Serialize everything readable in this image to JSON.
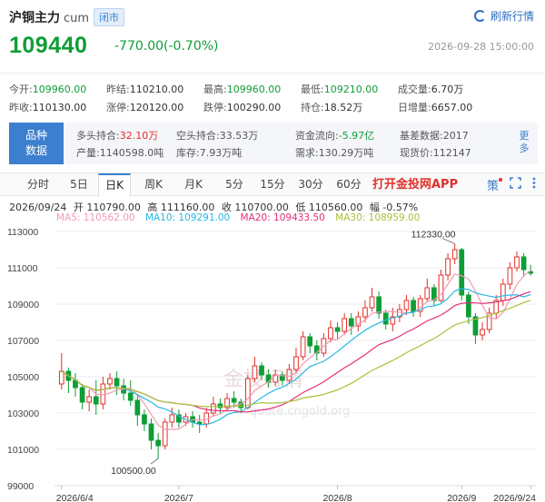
{
  "header": {
    "name": "沪铜主力",
    "code": "cum",
    "status_badge": "闭市",
    "refresh_label": "刷新行情"
  },
  "quote": {
    "price": "109440",
    "change": "-770.00(-0.70%)",
    "datetime": "2026-09-28 15:00:00"
  },
  "stats": {
    "row1": [
      {
        "label": "今开:",
        "value": "109960.00",
        "tone": "green"
      },
      {
        "label": "昨结:",
        "value": "110210.00",
        "tone": ""
      },
      {
        "label": "最高:",
        "value": "109960.00",
        "tone": "green"
      },
      {
        "label": "最低:",
        "value": "109210.00",
        "tone": "green"
      },
      {
        "label": "成交量:",
        "value": "6.70万",
        "tone": ""
      }
    ],
    "row2": [
      {
        "label": "昨收:",
        "value": "110130.00",
        "tone": ""
      },
      {
        "label": "涨停:",
        "value": "120120.00",
        "tone": ""
      },
      {
        "label": "跌停:",
        "value": "100290.00",
        "tone": ""
      },
      {
        "label": "持仓:",
        "value": "18.52万",
        "tone": ""
      },
      {
        "label": "日增量:",
        "value": "6657.00",
        "tone": ""
      }
    ]
  },
  "variety": {
    "tag_line1": "品种",
    "tag_line2": "数据",
    "row1": [
      {
        "label": "多头持合:",
        "value": "32.10万",
        "tone": "red"
      },
      {
        "label": "空头持合:",
        "value": "33.53万",
        "tone": ""
      },
      {
        "label": "资金流向:",
        "value": "-5.97亿",
        "tone": "green"
      },
      {
        "label": "基差数据:",
        "value": "2017",
        "tone": ""
      }
    ],
    "row2": [
      {
        "label": "产量:",
        "value": "1140598.0吨",
        "tone": ""
      },
      {
        "label": "库存:",
        "value": "7.93万吨",
        "tone": ""
      },
      {
        "label": "需求:",
        "value": "130.29万吨",
        "tone": ""
      },
      {
        "label": "现货价:",
        "value": "112147",
        "tone": ""
      }
    ],
    "more_label": "更多"
  },
  "tabs": {
    "items": [
      "分时",
      "5日",
      "日K",
      "周K",
      "月K",
      "5分",
      "15分",
      "30分",
      "60分"
    ],
    "active": "日K",
    "promo": "打开金投网APP",
    "icon_glyph": "策"
  },
  "ohlc": {
    "date": "2026/09/24",
    "open": "开 110790.00",
    "high": "高 111160.00",
    "close": "收 110700.00",
    "low": "低 110560.00",
    "amp": "幅 -0.57%"
  },
  "ma_legend": {
    "ma5": "MA5: 110562.00",
    "ma10": "MA10: 109291.00",
    "ma20": "MA20: 109433.50",
    "ma30": "MA30: 108959.00",
    "colors": {
      "ma5": "#f29ab5",
      "ma10": "#27b7e6",
      "ma20": "#e0307a",
      "ma30": "#a8c23a"
    }
  },
  "watermark": "金投行情",
  "watermark_url": "quote.cngold.org",
  "chart_data": {
    "type": "candlestick",
    "y_ticks": [
      "113000",
      "111000",
      "109000",
      "107000",
      "105000",
      "103000",
      "101000",
      "99000"
    ],
    "x_ticks": [
      "2026/6/4",
      "2026/7",
      "2026/8",
      "2026/9",
      "2026/9/24"
    ],
    "ylim": [
      99000,
      113000
    ],
    "annotations": {
      "high_label": "112330.00",
      "low_label": "100500.00"
    },
    "up_color": "#e0302a",
    "down_color": "#0f9d36",
    "candles": [
      [
        104600,
        105300,
        106300,
        104300
      ],
      [
        105300,
        104800,
        105500,
        104100
      ],
      [
        104800,
        104400,
        105200,
        103900
      ],
      [
        104400,
        103600,
        104600,
        103200
      ],
      [
        103600,
        103900,
        104300,
        103100
      ],
      [
        103900,
        103500,
        104800,
        102900
      ],
      [
        103500,
        104600,
        105000,
        103200
      ],
      [
        104600,
        104900,
        105200,
        104300
      ],
      [
        104900,
        104500,
        105300,
        104000
      ],
      [
        104500,
        104100,
        104900,
        103700
      ],
      [
        104100,
        103700,
        104800,
        103400
      ],
      [
        103700,
        102900,
        104000,
        102300
      ],
      [
        102900,
        102400,
        103200,
        102000
      ],
      [
        102400,
        101500,
        102700,
        101000
      ],
      [
        101500,
        101200,
        101900,
        100500
      ],
      [
        101200,
        102500,
        102700,
        101000
      ],
      [
        102500,
        102900,
        103300,
        102200
      ],
      [
        102900,
        102500,
        103200,
        102200
      ],
      [
        102500,
        102800,
        103000,
        102300
      ],
      [
        102800,
        102500,
        103100,
        102200
      ],
      [
        102500,
        102400,
        102900,
        101900
      ],
      [
        102400,
        103000,
        103300,
        102200
      ],
      [
        103000,
        103500,
        103900,
        102800
      ],
      [
        103500,
        103300,
        103800,
        103000
      ],
      [
        103300,
        103800,
        104100,
        103100
      ],
      [
        103800,
        103600,
        104200,
        103300
      ],
      [
        103600,
        103300,
        103800,
        103000
      ],
      [
        103300,
        104900,
        105100,
        103200
      ],
      [
        104900,
        105600,
        106100,
        104700
      ],
      [
        105600,
        105100,
        105800,
        104800
      ],
      [
        105100,
        104700,
        105400,
        104400
      ],
      [
        104700,
        105100,
        105400,
        104500
      ],
      [
        105100,
        104800,
        105300,
        104500
      ],
      [
        104800,
        105400,
        105700,
        104600
      ],
      [
        105400,
        106100,
        106600,
        105200
      ],
      [
        106100,
        107200,
        107500,
        105900
      ],
      [
        107200,
        106700,
        107400,
        106300
      ],
      [
        106700,
        106300,
        107000,
        105900
      ],
      [
        106300,
        107100,
        107400,
        106100
      ],
      [
        107100,
        107700,
        108100,
        106900
      ],
      [
        107700,
        107500,
        108000,
        107100
      ],
      [
        107500,
        108200,
        108500,
        107300
      ],
      [
        108200,
        107800,
        108500,
        107300
      ],
      [
        107800,
        108300,
        108600,
        107500
      ],
      [
        108300,
        108800,
        109200,
        108000
      ],
      [
        108800,
        109400,
        109900,
        108600
      ],
      [
        109400,
        108500,
        109700,
        108200
      ],
      [
        108500,
        107900,
        108700,
        107600
      ],
      [
        107900,
        108300,
        108800,
        107500
      ],
      [
        108300,
        108700,
        109000,
        108000
      ],
      [
        108700,
        109200,
        109500,
        108400
      ],
      [
        109200,
        108600,
        109400,
        108300
      ],
      [
        108600,
        109300,
        109500,
        108300
      ],
      [
        109300,
        109900,
        110400,
        109100
      ],
      [
        109900,
        109200,
        110100,
        108900
      ],
      [
        109200,
        110600,
        110900,
        109100
      ],
      [
        110600,
        111500,
        111800,
        110300
      ],
      [
        111500,
        112000,
        112330,
        111200
      ],
      [
        112000,
        109500,
        112100,
        109200
      ],
      [
        109500,
        108300,
        109700,
        107900
      ],
      [
        108300,
        107300,
        108500,
        106800
      ],
      [
        107300,
        107600,
        108000,
        107000
      ],
      [
        107600,
        108500,
        108800,
        107400
      ],
      [
        108500,
        109200,
        109500,
        108200
      ],
      [
        109200,
        110100,
        110400,
        108900
      ],
      [
        110100,
        111000,
        111300,
        109800
      ],
      [
        111000,
        111600,
        111900,
        110800
      ],
      [
        111600,
        110900,
        111800,
        110500
      ],
      [
        110790,
        110700,
        111160,
        110560
      ]
    ]
  }
}
